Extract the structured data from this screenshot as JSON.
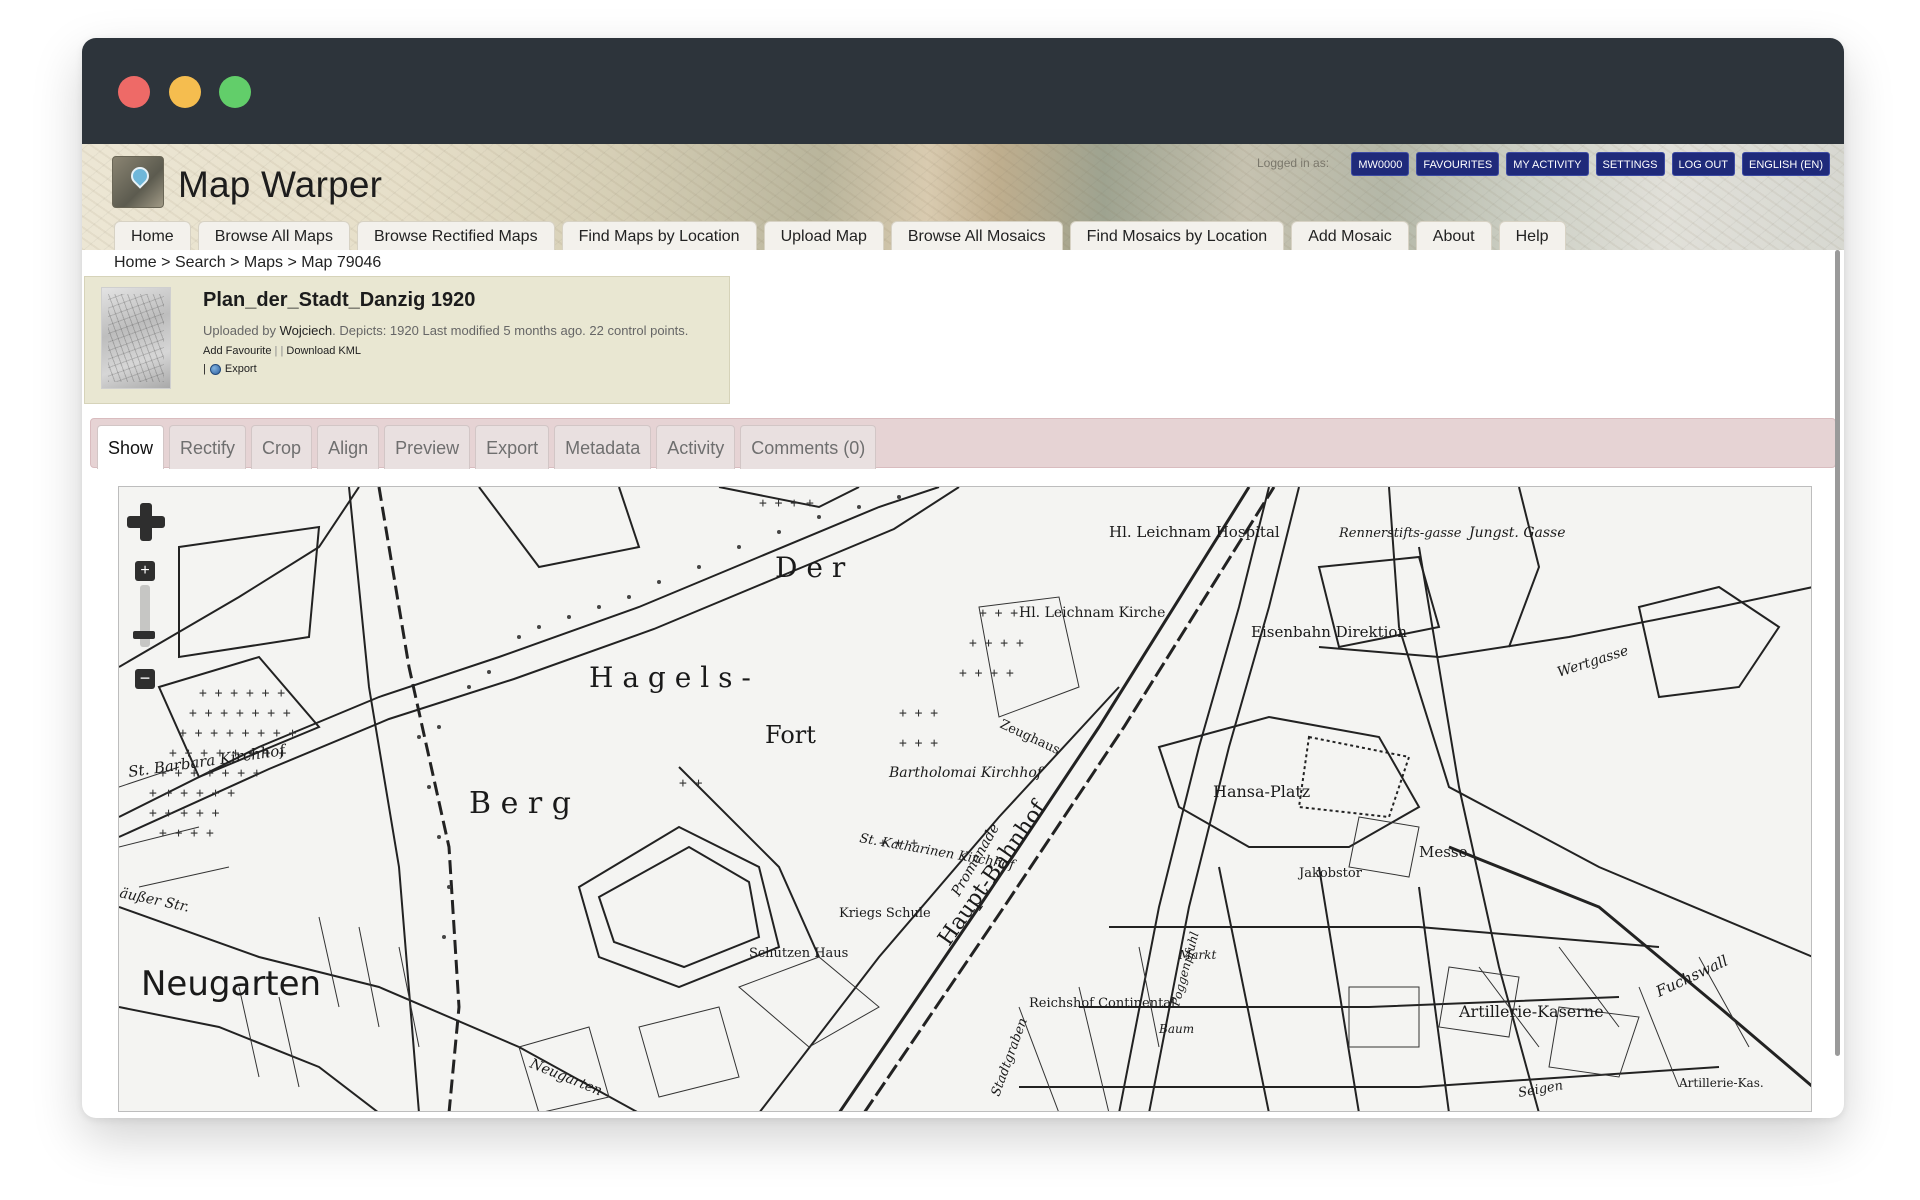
{
  "site": {
    "title": "Map Warper",
    "logged_in_label": "Logged in as:"
  },
  "userbar": [
    {
      "label": "MW0000"
    },
    {
      "label": "FAVOURITES"
    },
    {
      "label": "MY ACTIVITY"
    },
    {
      "label": "SETTINGS"
    },
    {
      "label": "LOG OUT"
    },
    {
      "label": "ENGLISH (EN)"
    }
  ],
  "nav": [
    {
      "label": "Home"
    },
    {
      "label": "Browse All Maps"
    },
    {
      "label": "Browse Rectified Maps"
    },
    {
      "label": "Find Maps by Location"
    },
    {
      "label": "Upload Map"
    },
    {
      "label": "Browse All Mosaics"
    },
    {
      "label": "Find Mosaics by Location"
    },
    {
      "label": "Add Mosaic"
    },
    {
      "label": "About"
    },
    {
      "label": "Help"
    }
  ],
  "breadcrumb": {
    "home": "Home",
    "search": "Search",
    "maps": "Maps",
    "current": "Map 79046",
    "separator": ">"
  },
  "map": {
    "title": "Plan_der_Stadt_Danzig 1920",
    "uploaded_by_label": "Uploaded by",
    "uploader": "Wojciech",
    "details": ". Depicts: 1920 Last modified 5 months ago. 22 control points.",
    "add_favourite": "Add Favourite",
    "download_kml": "Download KML",
    "link_separator": "| |",
    "export_prefix": "|",
    "export_label": "Export"
  },
  "tabs": [
    {
      "label": "Show",
      "active": true
    },
    {
      "label": "Rectify"
    },
    {
      "label": "Crop"
    },
    {
      "label": "Align"
    },
    {
      "label": "Preview"
    },
    {
      "label": "Export"
    },
    {
      "label": "Metadata"
    },
    {
      "label": "Activity"
    },
    {
      "label": "Comments (0)"
    }
  ],
  "map_labels": {
    "der": "D e r",
    "hagels": "H a g e l s -",
    "fort": "Fort",
    "berg": "B e r g",
    "neugarten": "Neugarten",
    "barbara": "St. Barbara Kirchhof",
    "leichnam": "Hl. Leichnam Hospital",
    "leichnam2": "Hl. Leichnam Kirche",
    "bartholomai": "Bartholomai Kirchhof",
    "katharinen": "St. Katharinen Kirchhof",
    "zeughaus": "Zeughaus",
    "hansa": "Hansa-Platz",
    "eisenbahn": "Eisenbahn Direktion",
    "jungst": "Jungst. Gasse",
    "wiesen": "Rennerstifts-gasse",
    "bahnhof": "Haupt-Bahnhof",
    "messe": "Messe",
    "artillerie": "Artillerie-Kaserne",
    "schutzen": "Schützen Haus",
    "kriegsschule": "Kriegs Schule",
    "reichshof": "Reichshof Continental",
    "jakobstor": "Jakobstor",
    "promenade": "Promenade",
    "fuchswall": "Fuchswall",
    "wertgasse": "Wertgasse",
    "ausser": "äußer Str.",
    "stadtgraben": "Stadtgraben",
    "sachsen": "Poggenpfuhl",
    "neugarten_str": "Neugarten",
    "markt": "Markt",
    "baum": "Baum",
    "seigen": "Seigen",
    "artkas": "Artillerie-Kas."
  }
}
